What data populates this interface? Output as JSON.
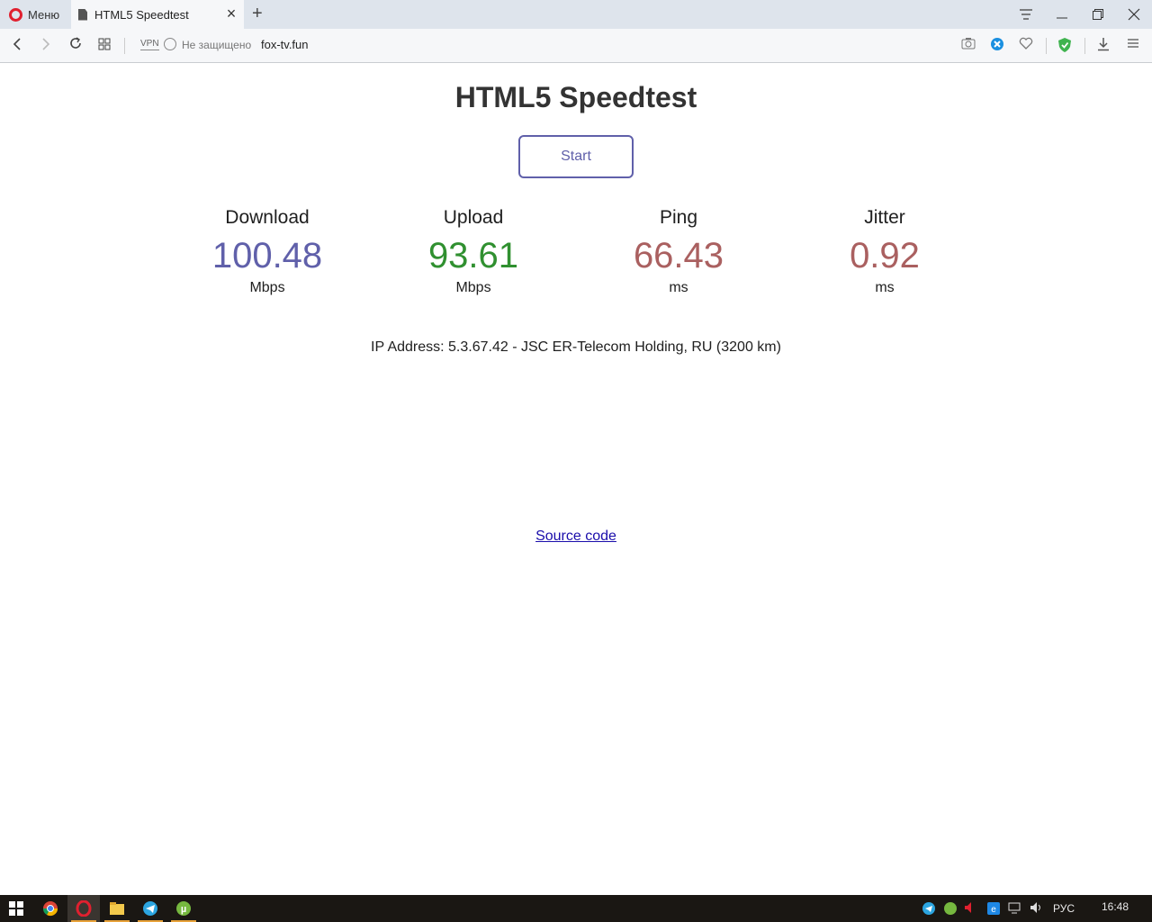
{
  "browser": {
    "menu_label": "Меню",
    "tab_title": "HTML5 Speedtest",
    "vpn_label": "VPN",
    "security_label": "Не защищено",
    "url": "fox-tv.fun"
  },
  "page": {
    "title": "HTML5 Speedtest",
    "start_label": "Start",
    "meters": [
      {
        "label": "Download",
        "value": "100.48",
        "unit": "Mbps",
        "color": "#6060aa"
      },
      {
        "label": "Upload",
        "value": "93.61",
        "unit": "Mbps",
        "color": "#309030"
      },
      {
        "label": "Ping",
        "value": "66.43",
        "unit": "ms",
        "color": "#aa6060"
      },
      {
        "label": "Jitter",
        "value": "0.92",
        "unit": "ms",
        "color": "#aa6060"
      }
    ],
    "ip_text": "IP Address: 5.3.67.42 - JSC ER-Telecom Holding, RU (3200 km)",
    "source_link": "Source code"
  },
  "taskbar": {
    "language": "РУС",
    "time": "16:48"
  }
}
